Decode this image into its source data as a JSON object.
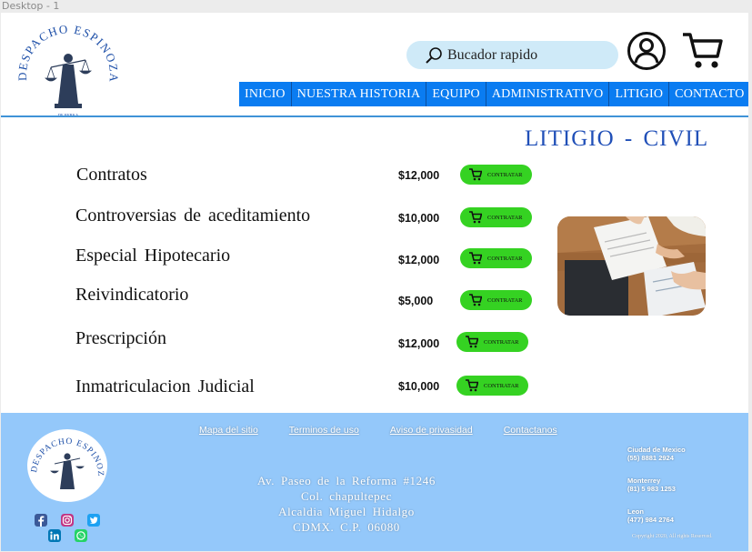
{
  "frame": {
    "label": "Desktop - 1"
  },
  "brand": {
    "name": "DESPACHO ESPINOZA",
    "tagline": "DE REBKA"
  },
  "search": {
    "placeholder": "Bucador rapido"
  },
  "nav": {
    "items": [
      "INICIO",
      "NUESTRA HISTORIA",
      "EQUIPO",
      "ADMINISTRATIVO",
      "LITIGIO",
      "CONTACTO"
    ]
  },
  "page": {
    "title": "LITIGIO - CIVIL"
  },
  "services": [
    {
      "name": "Contratos",
      "price": "$12,000",
      "button": "CONTRATAR"
    },
    {
      "name": "Controversias de aceditamiento",
      "price": "$10,000",
      "button": "CONTRATAR"
    },
    {
      "name": "Especial Hipotecario",
      "price": "$12,000",
      "button": "CONTRATAR"
    },
    {
      "name": "Reivindicatorio",
      "price": "$5,000",
      "button": "CONTRATAR"
    },
    {
      "name": "Prescripción",
      "price": "$12,000",
      "button": "CONTRATAR"
    },
    {
      "name": "Inmatriculacion Judicial",
      "price": "$10,000",
      "button": "CONTRATAR"
    }
  ],
  "footer": {
    "links": [
      "Mapa del sitio",
      "Terminos de uso",
      "Aviso de privasidad",
      "Contactanos"
    ],
    "address": [
      "Av. Paseo de la Reforma #1246",
      "Col. chapultepec",
      "Alcaldia Miguel Hidalgo",
      "CDMX. C.P. 06080"
    ],
    "offices": [
      {
        "city": "Ciudad de Mexico",
        "phone": "(55) 8881 2924"
      },
      {
        "city": "Monterrey",
        "phone": "(81) 5 983 1253"
      },
      {
        "city": "Leon",
        "phone": "(477) 984 2764"
      }
    ],
    "copyright": "Copyright 2020, All rights Reserved.",
    "social": [
      "facebook-icon",
      "instagram-icon",
      "twitter-icon",
      "linkedin-icon",
      "whatsapp-icon"
    ]
  },
  "colors": {
    "nav": "#0a7cf1",
    "accent_title": "#2150b8",
    "button": "#35d222",
    "footer": "#94c8fa",
    "search": "#cfeaf8"
  }
}
